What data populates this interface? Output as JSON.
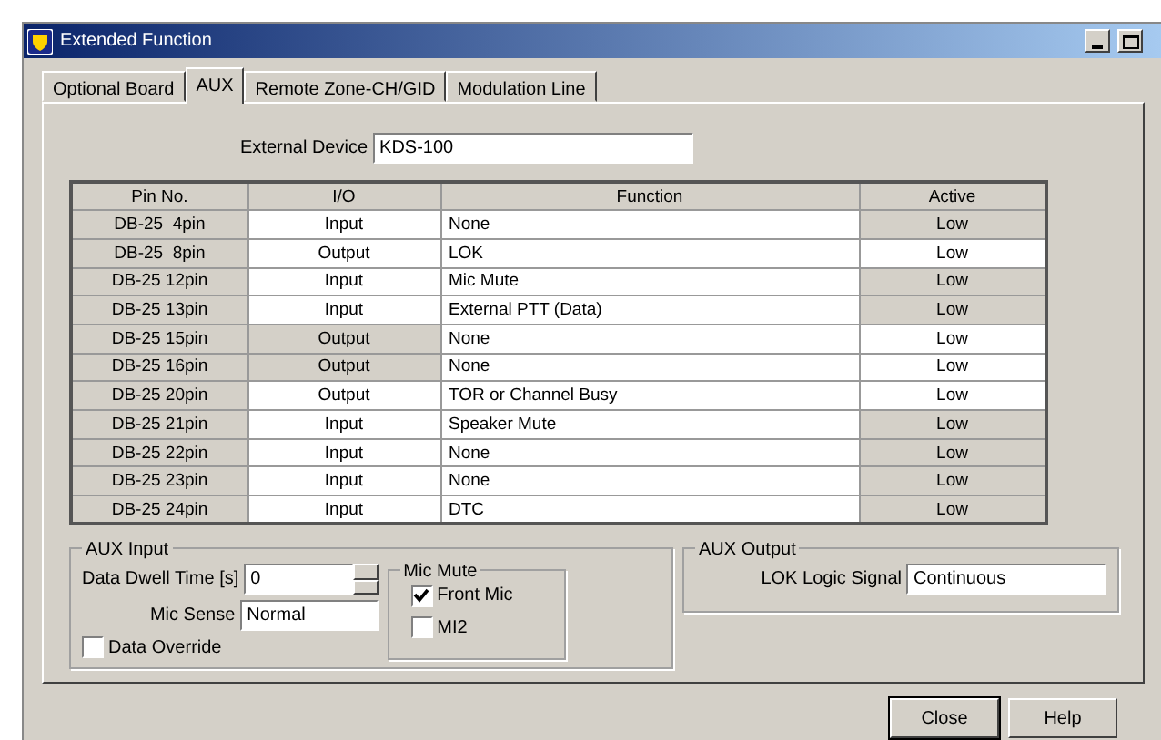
{
  "window": {
    "title": "Extended Function"
  },
  "tabs": [
    {
      "label": "Optional Board",
      "selected": false
    },
    {
      "label": "AUX",
      "selected": true
    },
    {
      "label": "Remote Zone-CH/GID",
      "selected": false
    },
    {
      "label": "Modulation Line",
      "selected": false
    }
  ],
  "external_device": {
    "label": "External Device",
    "value": "KDS-100"
  },
  "table": {
    "columns": [
      "Pin No.",
      "I/O",
      "Function",
      "Active"
    ],
    "rows": [
      {
        "pin": "DB-25  4pin",
        "io": "Input",
        "io_shaded": false,
        "function": "None",
        "active": "Low",
        "active_shaded": true
      },
      {
        "pin": "DB-25  8pin",
        "io": "Output",
        "io_shaded": false,
        "function": "LOK",
        "active": "Low",
        "active_shaded": false
      },
      {
        "pin": "DB-25 12pin",
        "io": "Input",
        "io_shaded": false,
        "function": "Mic Mute",
        "active": "Low",
        "active_shaded": true
      },
      {
        "pin": "DB-25 13pin",
        "io": "Input",
        "io_shaded": false,
        "function": "External PTT (Data)",
        "active": "Low",
        "active_shaded": true
      },
      {
        "pin": "DB-25 15pin",
        "io": "Output",
        "io_shaded": true,
        "function": "None",
        "active": "Low",
        "active_shaded": false
      },
      {
        "pin": "DB-25 16pin",
        "io": "Output",
        "io_shaded": true,
        "function": "None",
        "active": "Low",
        "active_shaded": false
      },
      {
        "pin": "DB-25 20pin",
        "io": "Output",
        "io_shaded": false,
        "function": "TOR or Channel Busy",
        "active": "Low",
        "active_shaded": false
      },
      {
        "pin": "DB-25 21pin",
        "io": "Input",
        "io_shaded": false,
        "function": "Speaker Mute",
        "active": "Low",
        "active_shaded": true
      },
      {
        "pin": "DB-25 22pin",
        "io": "Input",
        "io_shaded": false,
        "function": "None",
        "active": "Low",
        "active_shaded": true
      },
      {
        "pin": "DB-25 23pin",
        "io": "Input",
        "io_shaded": false,
        "function": "None",
        "active": "Low",
        "active_shaded": true
      },
      {
        "pin": "DB-25 24pin",
        "io": "Input",
        "io_shaded": false,
        "function": "DTC",
        "active": "Low",
        "active_shaded": true
      }
    ]
  },
  "aux_input": {
    "title": "AUX Input",
    "data_dwell_label": "Data Dwell Time [s]",
    "data_dwell_value": "0",
    "mic_sense_label": "Mic Sense",
    "mic_sense_value": "Normal",
    "data_override": {
      "label": "Data Override",
      "checked": false
    },
    "mic_mute": {
      "title": "Mic Mute",
      "options": [
        {
          "label": "Front Mic",
          "checked": true
        },
        {
          "label": "MI2",
          "checked": false
        }
      ]
    }
  },
  "aux_output": {
    "title": "AUX Output",
    "lok_label": "LOK Logic Signal",
    "lok_value": "Continuous"
  },
  "buttons": [
    {
      "label": "Close",
      "default": true
    },
    {
      "label": "Help",
      "default": false
    }
  ]
}
